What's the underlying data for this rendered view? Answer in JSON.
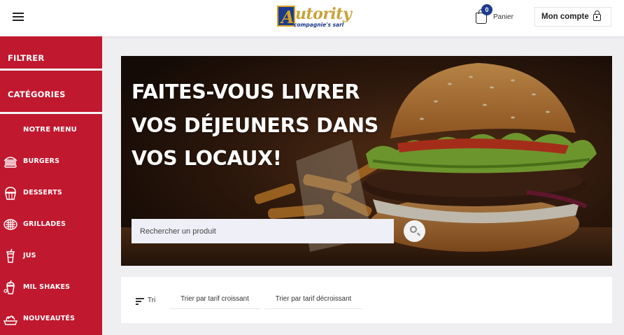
{
  "header": {
    "menu_icon": "hamburger-menu-icon",
    "logo": {
      "letter": "A",
      "word": "utority",
      "tagline": "compagnie's sarl"
    },
    "cart": {
      "count": "0",
      "label": "Panier",
      "icon": "shopping-bag-icon"
    },
    "account": {
      "label": "Mon compte",
      "icon": "lock-icon"
    }
  },
  "sidebar": {
    "filter_label": "FILTRER",
    "categories_label": "CATÉGORIES",
    "menu_title": "NOTRE MENU",
    "items": [
      {
        "label": "BURGERS",
        "icon": "burger-icon"
      },
      {
        "label": "DESSERTS",
        "icon": "cupcake-icon"
      },
      {
        "label": "GRILLADES",
        "icon": "grill-icon"
      },
      {
        "label": "JUS",
        "icon": "juice-cup-icon"
      },
      {
        "label": "MIL SHAKES",
        "icon": "milkshake-icon"
      },
      {
        "label": "NOUVEAUTÉS",
        "icon": "new-items-icon"
      }
    ]
  },
  "hero": {
    "title_lines": [
      "FAITES-VOUS LIVRER",
      "VOS DÉJEUNERS DANS",
      "VOS LOCAUX!"
    ],
    "search_placeholder": "Rechercher un produit",
    "search_icon": "search-icon"
  },
  "sort": {
    "label": "Tri",
    "icon": "sort-lines-icon",
    "options": [
      "Trier par tarif croissant",
      "Trier par tarif décroissant"
    ]
  },
  "colors": {
    "sidebar_red": "#c0182f",
    "brand_blue": "#1d3a8c",
    "brand_gold": "#c9a23a",
    "page_bg": "#efeff2"
  }
}
